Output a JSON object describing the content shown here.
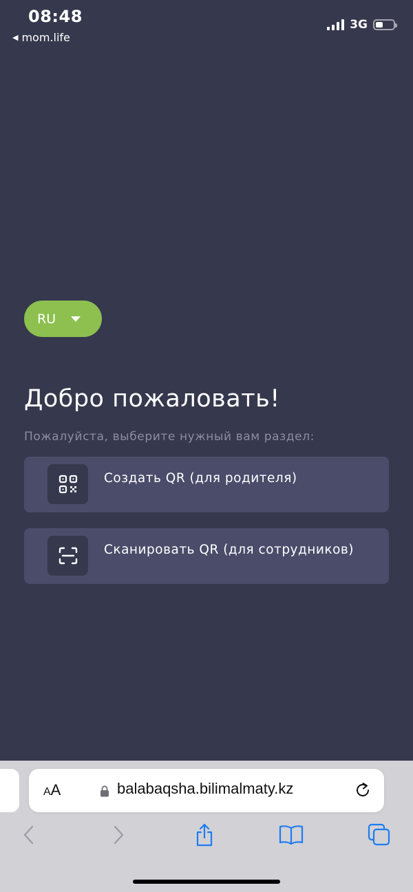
{
  "status_bar": {
    "time": "08:48",
    "back_app": "mom.life",
    "network": "3G"
  },
  "language": {
    "selected": "RU"
  },
  "main": {
    "title": "Добро пожаловать!",
    "subtitle": "Пожалуйста, выберите нужный вам раздел:",
    "options": [
      {
        "label": "Создать QR (для родителя)",
        "icon": "qr-code-icon"
      },
      {
        "label": "Сканировать QR (для сотрудников)",
        "icon": "scan-icon"
      }
    ]
  },
  "browser": {
    "text_size_label_small": "A",
    "text_size_label_large": "A",
    "url": "balabaqsha.bilimalmaty.kz"
  },
  "colors": {
    "background": "#36384d",
    "card": "#4a4c6a",
    "accent_green": "#8dc04f",
    "ios_blue": "#1e7bf2"
  }
}
